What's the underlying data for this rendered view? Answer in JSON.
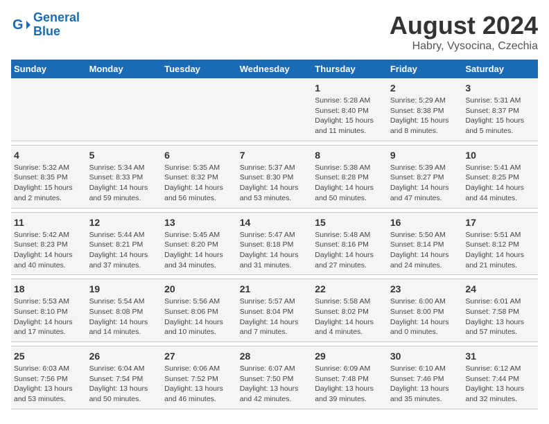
{
  "header": {
    "logo_line1": "General",
    "logo_line2": "Blue",
    "main_title": "August 2024",
    "subtitle": "Habry, Vysocina, Czechia"
  },
  "days_of_week": [
    "Sunday",
    "Monday",
    "Tuesday",
    "Wednesday",
    "Thursday",
    "Friday",
    "Saturday"
  ],
  "weeks": [
    [
      {
        "day": "",
        "info": ""
      },
      {
        "day": "",
        "info": ""
      },
      {
        "day": "",
        "info": ""
      },
      {
        "day": "",
        "info": ""
      },
      {
        "day": "1",
        "info": "Sunrise: 5:28 AM\nSunset: 8:40 PM\nDaylight: 15 hours\nand 11 minutes."
      },
      {
        "day": "2",
        "info": "Sunrise: 5:29 AM\nSunset: 8:38 PM\nDaylight: 15 hours\nand 8 minutes."
      },
      {
        "day": "3",
        "info": "Sunrise: 5:31 AM\nSunset: 8:37 PM\nDaylight: 15 hours\nand 5 minutes."
      }
    ],
    [
      {
        "day": "4",
        "info": "Sunrise: 5:32 AM\nSunset: 8:35 PM\nDaylight: 15 hours\nand 2 minutes."
      },
      {
        "day": "5",
        "info": "Sunrise: 5:34 AM\nSunset: 8:33 PM\nDaylight: 14 hours\nand 59 minutes."
      },
      {
        "day": "6",
        "info": "Sunrise: 5:35 AM\nSunset: 8:32 PM\nDaylight: 14 hours\nand 56 minutes."
      },
      {
        "day": "7",
        "info": "Sunrise: 5:37 AM\nSunset: 8:30 PM\nDaylight: 14 hours\nand 53 minutes."
      },
      {
        "day": "8",
        "info": "Sunrise: 5:38 AM\nSunset: 8:28 PM\nDaylight: 14 hours\nand 50 minutes."
      },
      {
        "day": "9",
        "info": "Sunrise: 5:39 AM\nSunset: 8:27 PM\nDaylight: 14 hours\nand 47 minutes."
      },
      {
        "day": "10",
        "info": "Sunrise: 5:41 AM\nSunset: 8:25 PM\nDaylight: 14 hours\nand 44 minutes."
      }
    ],
    [
      {
        "day": "11",
        "info": "Sunrise: 5:42 AM\nSunset: 8:23 PM\nDaylight: 14 hours\nand 40 minutes."
      },
      {
        "day": "12",
        "info": "Sunrise: 5:44 AM\nSunset: 8:21 PM\nDaylight: 14 hours\nand 37 minutes."
      },
      {
        "day": "13",
        "info": "Sunrise: 5:45 AM\nSunset: 8:20 PM\nDaylight: 14 hours\nand 34 minutes."
      },
      {
        "day": "14",
        "info": "Sunrise: 5:47 AM\nSunset: 8:18 PM\nDaylight: 14 hours\nand 31 minutes."
      },
      {
        "day": "15",
        "info": "Sunrise: 5:48 AM\nSunset: 8:16 PM\nDaylight: 14 hours\nand 27 minutes."
      },
      {
        "day": "16",
        "info": "Sunrise: 5:50 AM\nSunset: 8:14 PM\nDaylight: 14 hours\nand 24 minutes."
      },
      {
        "day": "17",
        "info": "Sunrise: 5:51 AM\nSunset: 8:12 PM\nDaylight: 14 hours\nand 21 minutes."
      }
    ],
    [
      {
        "day": "18",
        "info": "Sunrise: 5:53 AM\nSunset: 8:10 PM\nDaylight: 14 hours\nand 17 minutes."
      },
      {
        "day": "19",
        "info": "Sunrise: 5:54 AM\nSunset: 8:08 PM\nDaylight: 14 hours\nand 14 minutes."
      },
      {
        "day": "20",
        "info": "Sunrise: 5:56 AM\nSunset: 8:06 PM\nDaylight: 14 hours\nand 10 minutes."
      },
      {
        "day": "21",
        "info": "Sunrise: 5:57 AM\nSunset: 8:04 PM\nDaylight: 14 hours\nand 7 minutes."
      },
      {
        "day": "22",
        "info": "Sunrise: 5:58 AM\nSunset: 8:02 PM\nDaylight: 14 hours\nand 4 minutes."
      },
      {
        "day": "23",
        "info": "Sunrise: 6:00 AM\nSunset: 8:00 PM\nDaylight: 14 hours\nand 0 minutes."
      },
      {
        "day": "24",
        "info": "Sunrise: 6:01 AM\nSunset: 7:58 PM\nDaylight: 13 hours\nand 57 minutes."
      }
    ],
    [
      {
        "day": "25",
        "info": "Sunrise: 6:03 AM\nSunset: 7:56 PM\nDaylight: 13 hours\nand 53 minutes."
      },
      {
        "day": "26",
        "info": "Sunrise: 6:04 AM\nSunset: 7:54 PM\nDaylight: 13 hours\nand 50 minutes."
      },
      {
        "day": "27",
        "info": "Sunrise: 6:06 AM\nSunset: 7:52 PM\nDaylight: 13 hours\nand 46 minutes."
      },
      {
        "day": "28",
        "info": "Sunrise: 6:07 AM\nSunset: 7:50 PM\nDaylight: 13 hours\nand 42 minutes."
      },
      {
        "day": "29",
        "info": "Sunrise: 6:09 AM\nSunset: 7:48 PM\nDaylight: 13 hours\nand 39 minutes."
      },
      {
        "day": "30",
        "info": "Sunrise: 6:10 AM\nSunset: 7:46 PM\nDaylight: 13 hours\nand 35 minutes."
      },
      {
        "day": "31",
        "info": "Sunrise: 6:12 AM\nSunset: 7:44 PM\nDaylight: 13 hours\nand 32 minutes."
      }
    ]
  ]
}
